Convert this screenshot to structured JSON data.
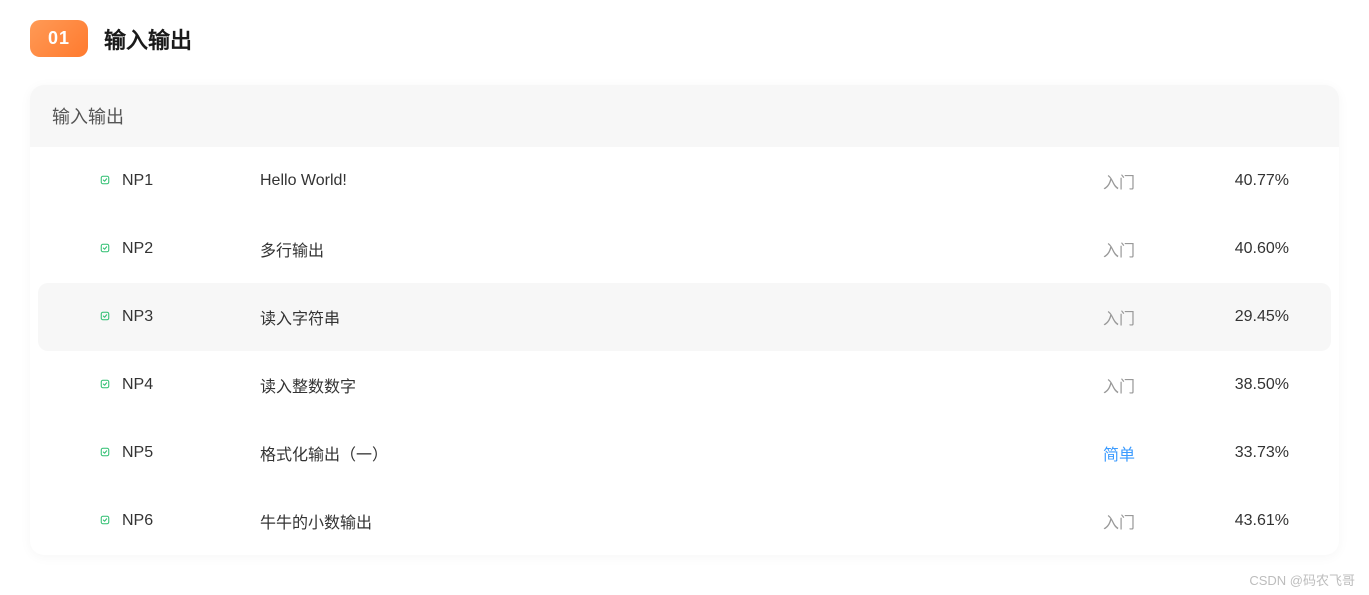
{
  "section": {
    "number": "01",
    "title": "输入输出"
  },
  "card": {
    "header": "输入输出"
  },
  "problems": [
    {
      "code": "NP1",
      "title": "Hello World!",
      "difficulty": "入门",
      "difficulty_type": "entry",
      "percent": "40.77%"
    },
    {
      "code": "NP2",
      "title": "多行输出",
      "difficulty": "入门",
      "difficulty_type": "entry",
      "percent": "40.60%"
    },
    {
      "code": "NP3",
      "title": "读入字符串",
      "difficulty": "入门",
      "difficulty_type": "entry",
      "percent": "29.45%",
      "hovered": true
    },
    {
      "code": "NP4",
      "title": "读入整数数字",
      "difficulty": "入门",
      "difficulty_type": "entry",
      "percent": "38.50%"
    },
    {
      "code": "NP5",
      "title": "格式化输出（一）",
      "difficulty": "简单",
      "difficulty_type": "easy",
      "percent": "33.73%"
    },
    {
      "code": "NP6",
      "title": "牛牛的小数输出",
      "difficulty": "入门",
      "difficulty_type": "entry",
      "percent": "43.61%"
    }
  ],
  "watermark": "CSDN @码农飞哥"
}
